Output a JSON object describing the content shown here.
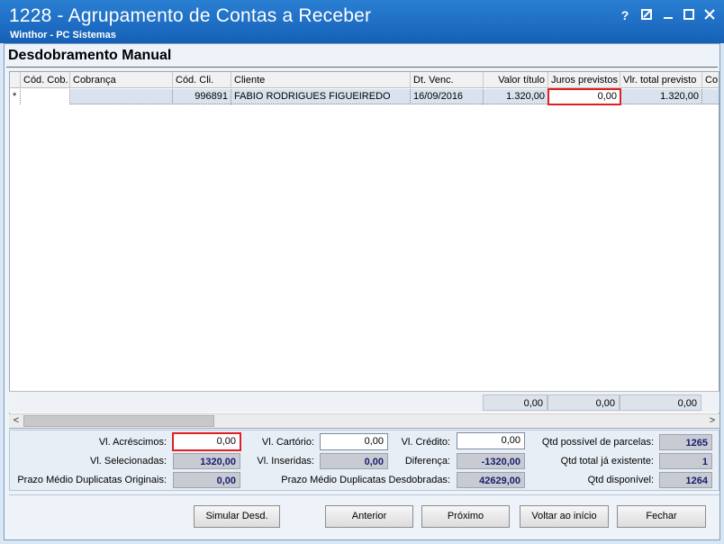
{
  "window": {
    "title": "1228 - Agrupamento de Contas a Receber",
    "subtitle": "Winthor - PC Sistemas",
    "controls": {
      "help": "?",
      "edit": "✎",
      "minimize": "–",
      "maximize": "☐",
      "close": "✕"
    }
  },
  "panel": {
    "title": "Desdobramento Manual"
  },
  "grid": {
    "columns": [
      "Cód. Cob.",
      "Cobrança",
      "Cód. Cli.",
      "Cliente",
      "Dt. Venc.",
      "Valor título",
      "Juros previstos",
      "Vlr. total previsto",
      "Co"
    ],
    "row": {
      "marker": "*",
      "cod_cob": "",
      "cobranca": "",
      "cod_cli": "996891",
      "cliente": "FABIO RODRIGUES FIGUEIREDO",
      "dt_venc": "16/09/2016",
      "valor_titulo": "1.320,00",
      "juros_previstos": "0,00",
      "vlr_total_previsto": "1.320,00"
    },
    "totals": {
      "valor_titulo": "0,00",
      "juros_previstos": "0,00",
      "vlr_total_previsto": "0,00"
    }
  },
  "scrollbar": {
    "left_arrow": "<",
    "right_arrow": ">"
  },
  "form": {
    "vl_acrescimos": {
      "label": "Vl. Acréscimos:",
      "value": "0,00"
    },
    "vl_cartorio": {
      "label": "Vl. Cartório:",
      "value": "0,00"
    },
    "vl_credito": {
      "label": "Vl. Crédito:",
      "value": "0,00"
    },
    "qtd_possivel": {
      "label": "Qtd possível de parcelas:",
      "value": "1265"
    },
    "vl_selecionadas": {
      "label": "Vl. Selecionadas:",
      "value": "1320,00"
    },
    "vl_inseridas": {
      "label": "Vl. Inseridas:",
      "value": "0,00"
    },
    "diferenca": {
      "label": "Diferença:",
      "value": "-1320,00"
    },
    "qtd_total": {
      "label": "Qtd total já existente:",
      "value": "1"
    },
    "prazo_originais": {
      "label": "Prazo Médio Duplicatas Originais:",
      "value": "0,00"
    },
    "prazo_desdobradas": {
      "label": "Prazo Médio Duplicatas Desdobradas:",
      "value": "42629,00"
    },
    "qtd_disponivel": {
      "label": "Qtd disponível:",
      "value": "1264"
    }
  },
  "buttons": {
    "simular": "Simular Desd.",
    "anterior": "Anterior",
    "proximo": "Próximo",
    "voltar": "Voltar ao início",
    "fechar": "Fechar"
  }
}
